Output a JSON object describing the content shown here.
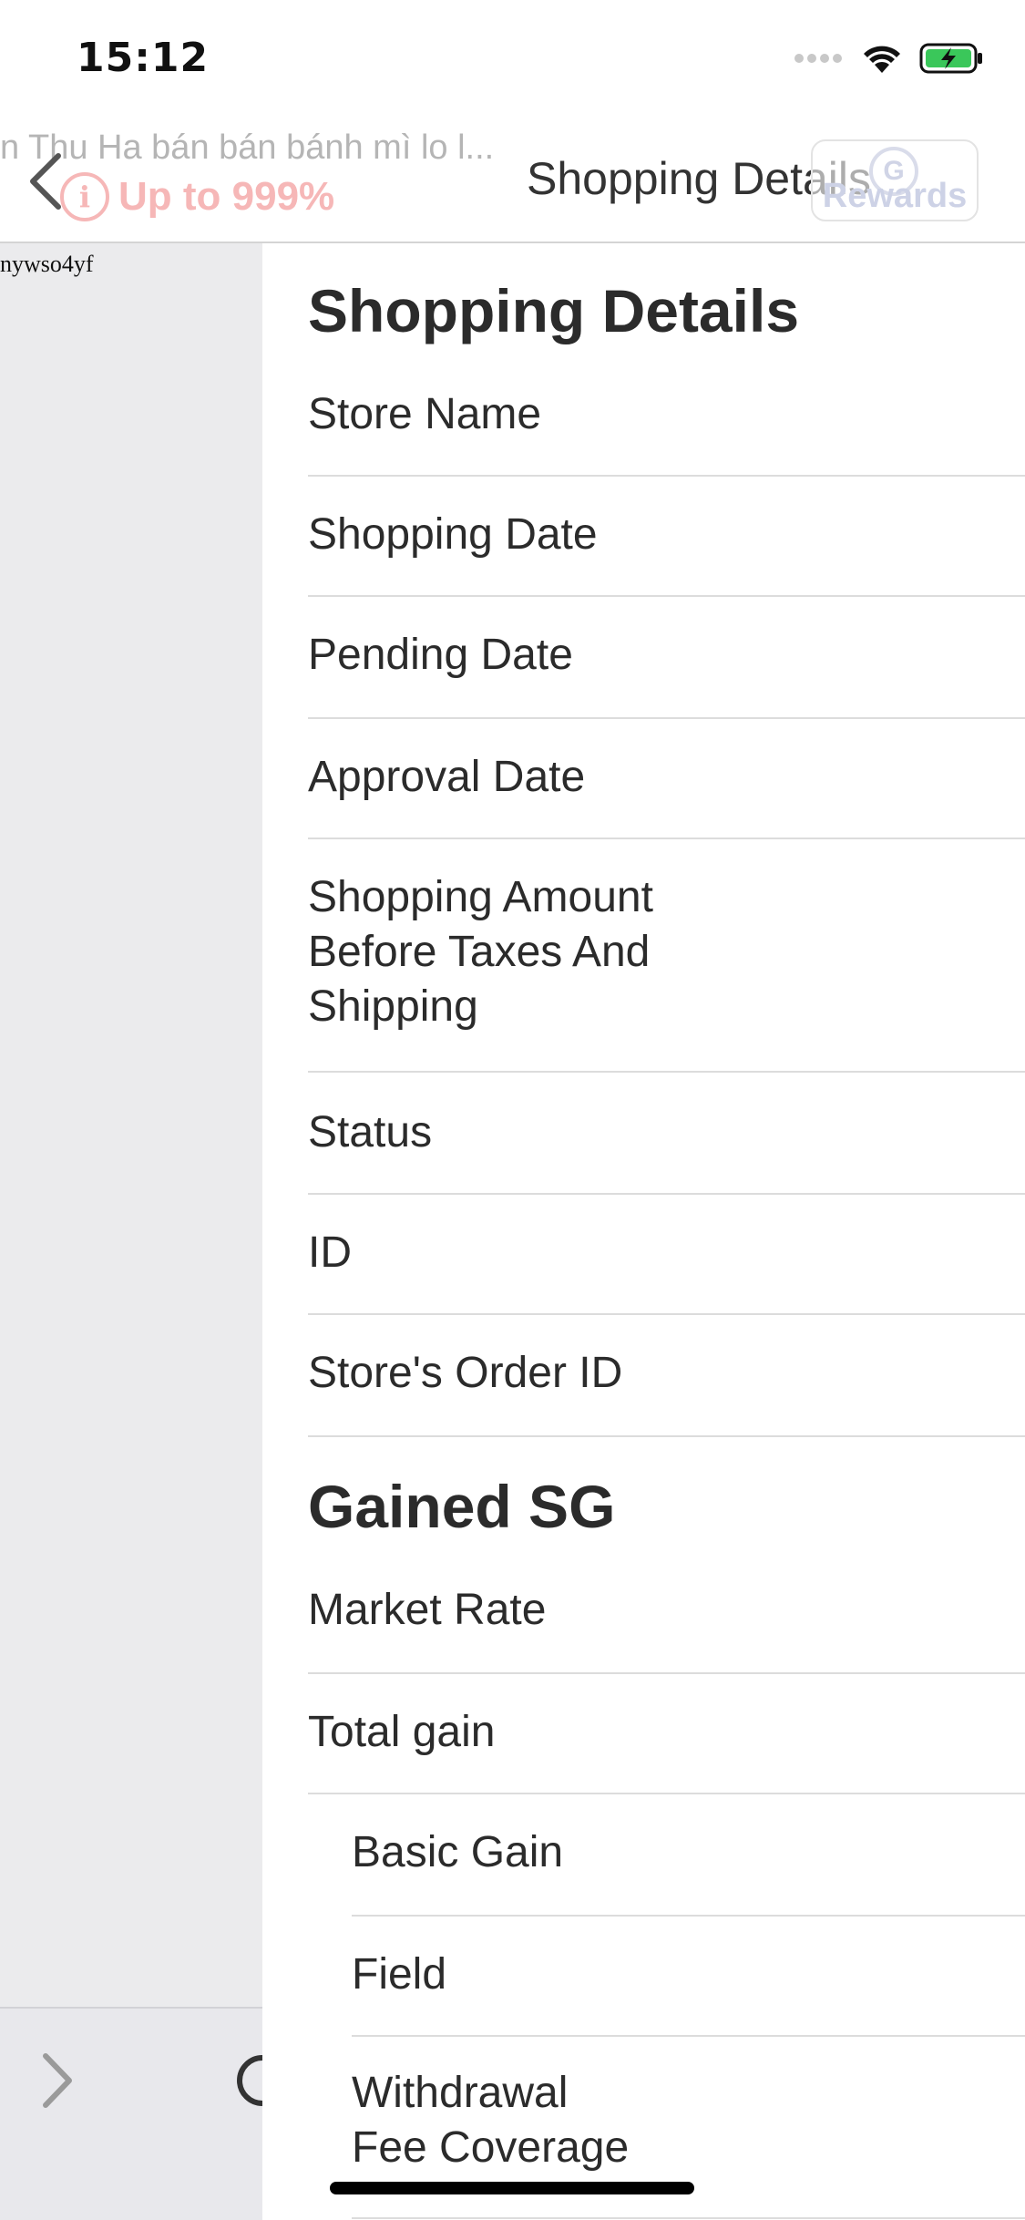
{
  "status_bar": {
    "time": "15:12"
  },
  "background_page": {
    "store_title": "n Thu Ha bán bán bánh mì lo l...",
    "promo_text": "Up to 999%",
    "info_glyph": "i",
    "left_text": "nywso4yf"
  },
  "nav": {
    "title": "Shopping Details",
    "rewards_label": "Rewards",
    "rewards_logo_glyph": "G"
  },
  "panel": {
    "shopping_section_title": "Shopping Details",
    "shopping_rows": [
      {
        "label": "Store Name"
      },
      {
        "label": "Shopping Date"
      },
      {
        "label": "Pending Date"
      },
      {
        "label": "Approval Date"
      },
      {
        "label_lines": [
          "Shopping Amount",
          "Before Taxes And",
          "Shipping"
        ]
      },
      {
        "label": "Status"
      },
      {
        "label": "ID"
      },
      {
        "label": "Store's Order ID"
      }
    ],
    "gained_section_title": "Gained SG",
    "gained_rows": [
      {
        "label": "Market Rate"
      },
      {
        "label": "Total gain"
      }
    ],
    "gain_breakdown_rows": [
      {
        "label": "Basic Gain"
      },
      {
        "label": "Field"
      },
      {
        "label_lines": [
          "Withdrawal",
          "Fee Coverage"
        ]
      }
    ]
  },
  "colors": {
    "promo_pink": "#f6b7b7",
    "text_dark": "#2b2b2b",
    "divider": "#dcdcdc",
    "left_bg": "#ebebed"
  }
}
